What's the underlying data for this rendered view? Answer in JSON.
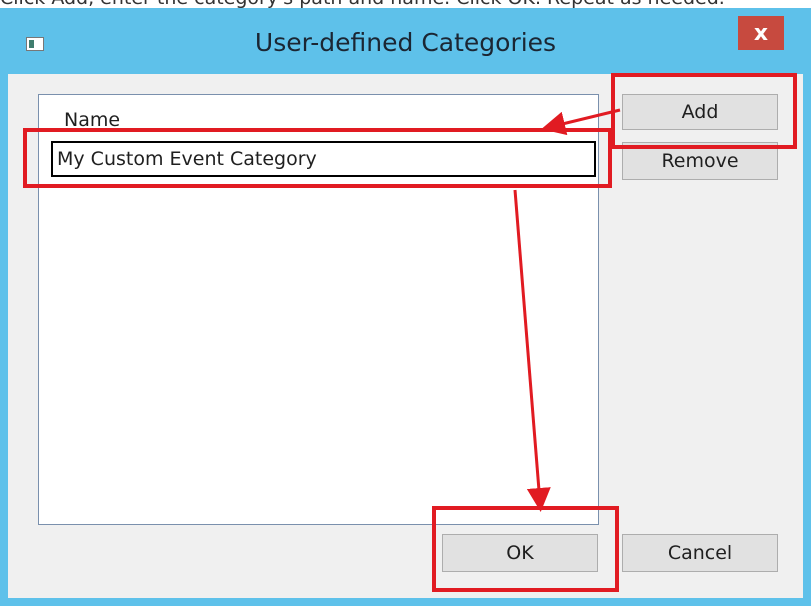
{
  "window": {
    "title": "User-defined Categories",
    "close_label": "x",
    "background_color": "#5ec1ea"
  },
  "list": {
    "column_header": "Name",
    "rows": [
      {
        "name": "My Custom Event Category"
      }
    ]
  },
  "buttons": {
    "add_label": "Add",
    "remove_label": "Remove",
    "ok_label": "OK",
    "cancel_label": "Cancel"
  },
  "annotations": {
    "highlight_color": "#e11b22",
    "arrow_color": "#e11b22"
  }
}
